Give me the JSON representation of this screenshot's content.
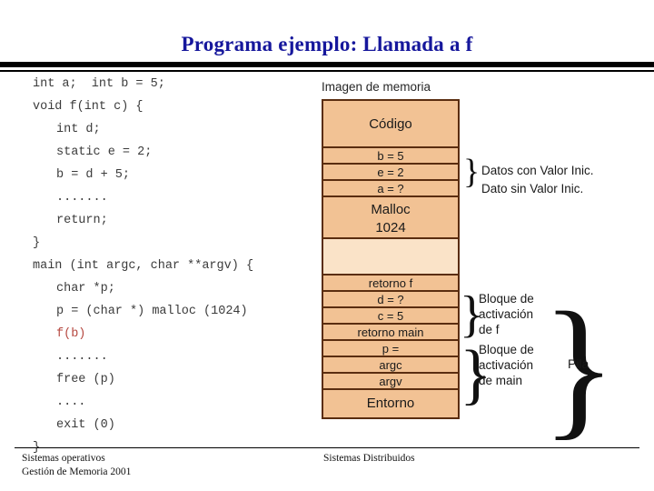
{
  "slide": {
    "title": "Programa ejemplo: Llamada a f"
  },
  "code": {
    "lines": [
      {
        "text": "int a;  int b = 5;",
        "indent": false,
        "highlight": false
      },
      {
        "text": "void f(int c) {",
        "indent": false,
        "highlight": false
      },
      {
        "text": "int d;",
        "indent": true,
        "highlight": false
      },
      {
        "text": "static e = 2;",
        "indent": true,
        "highlight": false
      },
      {
        "text": "b = d + 5;",
        "indent": true,
        "highlight": false
      },
      {
        "text": ".......",
        "indent": true,
        "highlight": false
      },
      {
        "text": "return;",
        "indent": true,
        "highlight": false
      },
      {
        "text": "}",
        "indent": false,
        "highlight": false
      },
      {
        "text": "main (int argc, char **argv) {",
        "indent": false,
        "highlight": false
      },
      {
        "text": "char *p;",
        "indent": true,
        "highlight": false
      },
      {
        "text": "p = (char *) malloc (1024)",
        "indent": true,
        "highlight": false
      },
      {
        "text": "f(b)",
        "indent": true,
        "highlight": true
      },
      {
        "text": ".......",
        "indent": true,
        "highlight": false
      },
      {
        "text": "free (p)",
        "indent": true,
        "highlight": false
      },
      {
        "text": "....",
        "indent": true,
        "highlight": false
      },
      {
        "text": "exit (0)",
        "indent": true,
        "highlight": false
      },
      {
        "text": "}",
        "indent": false,
        "highlight": false
      }
    ]
  },
  "diagram": {
    "caption": "Imagen de memoria",
    "box_fill_color": "#f2c294",
    "free_fill_color": "#fae3c8",
    "border_color": "#5a2d10",
    "rows": [
      {
        "label": "Código",
        "kind": "tall"
      },
      {
        "label": "b = 5",
        "kind": "row"
      },
      {
        "label": "e = 2",
        "kind": "row"
      },
      {
        "label": "a = ?",
        "kind": "row"
      },
      {
        "label": "Malloc",
        "sublabel": "1024",
        "kind": "tall2"
      },
      {
        "label": "",
        "kind": "free"
      },
      {
        "label": "retorno f",
        "kind": "row"
      },
      {
        "label": "d = ?",
        "kind": "row"
      },
      {
        "label": "c = 5",
        "kind": "row"
      },
      {
        "label": "retorno main",
        "kind": "row"
      },
      {
        "label": "p =",
        "kind": "row"
      },
      {
        "label": "argc",
        "kind": "row"
      },
      {
        "label": "argv",
        "kind": "row"
      },
      {
        "label": "Entorno",
        "kind": "entorno"
      }
    ],
    "annotations": {
      "datos_con_valor": "Datos con Valor Inic.",
      "dato_sin_valor": "Dato sin Valor Inic.",
      "bloque_f": "Bloque de\nactivación\nde f",
      "bloque_main": "Bloque de\nactivación\nde main",
      "pila": "Pila"
    }
  },
  "footer": {
    "left_line1": "Sistemas operativos",
    "left_line2": "Gestión de Memoria 2001",
    "right": "Sistemas Distribuidos"
  }
}
